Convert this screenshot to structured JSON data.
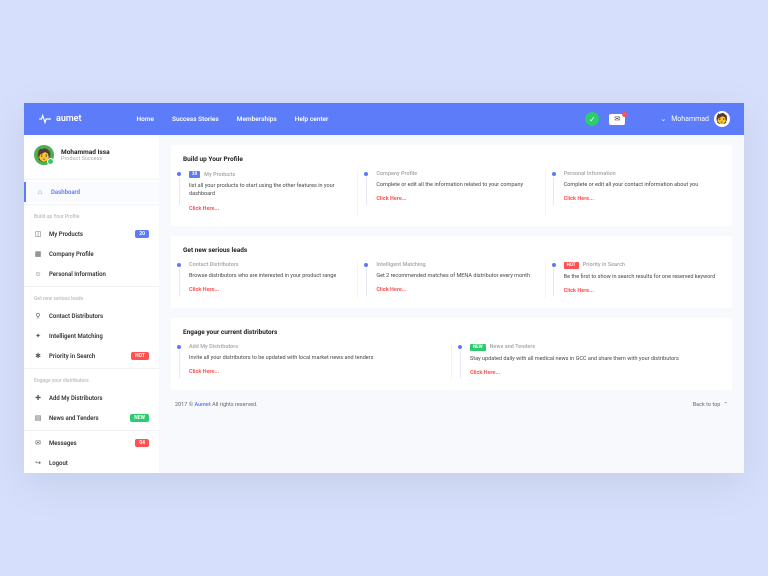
{
  "brand": "aumet",
  "nav": {
    "home": "Home",
    "success": "Success Stories",
    "memberships": "Memberships",
    "help": "Help center"
  },
  "user": {
    "name": "Mohammad"
  },
  "profile": {
    "name": "Mohammad Issa",
    "role": "Product Success"
  },
  "sidebar": {
    "dashboard": "Dashboard",
    "group1": "Build up Your Profile",
    "my_products": "My Products",
    "my_products_badge": "20",
    "company_profile": "Company Profile",
    "personal_info": "Personal Information",
    "group2": "Get new serious leads",
    "contact_dist": "Contact Distributors",
    "intelligent": "Intelligent Matching",
    "priority": "Priority in Search",
    "priority_badge": "HOT",
    "group3": "Engage your distributors",
    "add_dist": "Add My Distributors",
    "news": "News and Tenders",
    "news_badge": "NEW",
    "messages": "Messages",
    "messages_badge": "04",
    "logout": "Logout"
  },
  "sections": [
    {
      "title": "Build up Your Profile",
      "cards": [
        {
          "title": "My Products",
          "badge": "20",
          "badge_class": "badge-blue",
          "desc": "list all your products to start using the other features in your dashboard",
          "link": "Click Here..."
        },
        {
          "title": "Company Profile",
          "desc": "Complete or edit all the information related to your company",
          "link": "Click Here..."
        },
        {
          "title": "Personal Information",
          "desc": "Complete or edit all your contact information about you",
          "link": "Click Here..."
        }
      ]
    },
    {
      "title": "Get new serious leads",
      "cards": [
        {
          "title": "Contact Distributors",
          "desc": "Browse distributors who are interested in your product range",
          "link": "Click Here..."
        },
        {
          "title": "Intelligent Matching",
          "desc": "Get 2 recommended matches of MENA distributor every month",
          "link": "Click Here..."
        },
        {
          "title": "Priority in Search",
          "badge": "HOT",
          "badge_class": "badge-red",
          "desc": "Be the first to show in search results for one reserved keyword",
          "link": "Click Here..."
        }
      ]
    },
    {
      "title": "Engage your current distributors",
      "cards": [
        {
          "title": "Add My Distributors",
          "desc": "Invite all your distributors to be updated with local market news and tenders",
          "link": "Click Here..."
        },
        {
          "title": "News and Tenders",
          "badge": "NEW",
          "badge_class": "badge-green",
          "desc": "Stay updated daily with all medical news in GCC and share them with your distributors",
          "link": "Click Here..."
        }
      ]
    }
  ],
  "footer": {
    "year": "2017 ©",
    "brand": "Aumet",
    "rest": " All rights reserved.",
    "back": "Back to top"
  }
}
